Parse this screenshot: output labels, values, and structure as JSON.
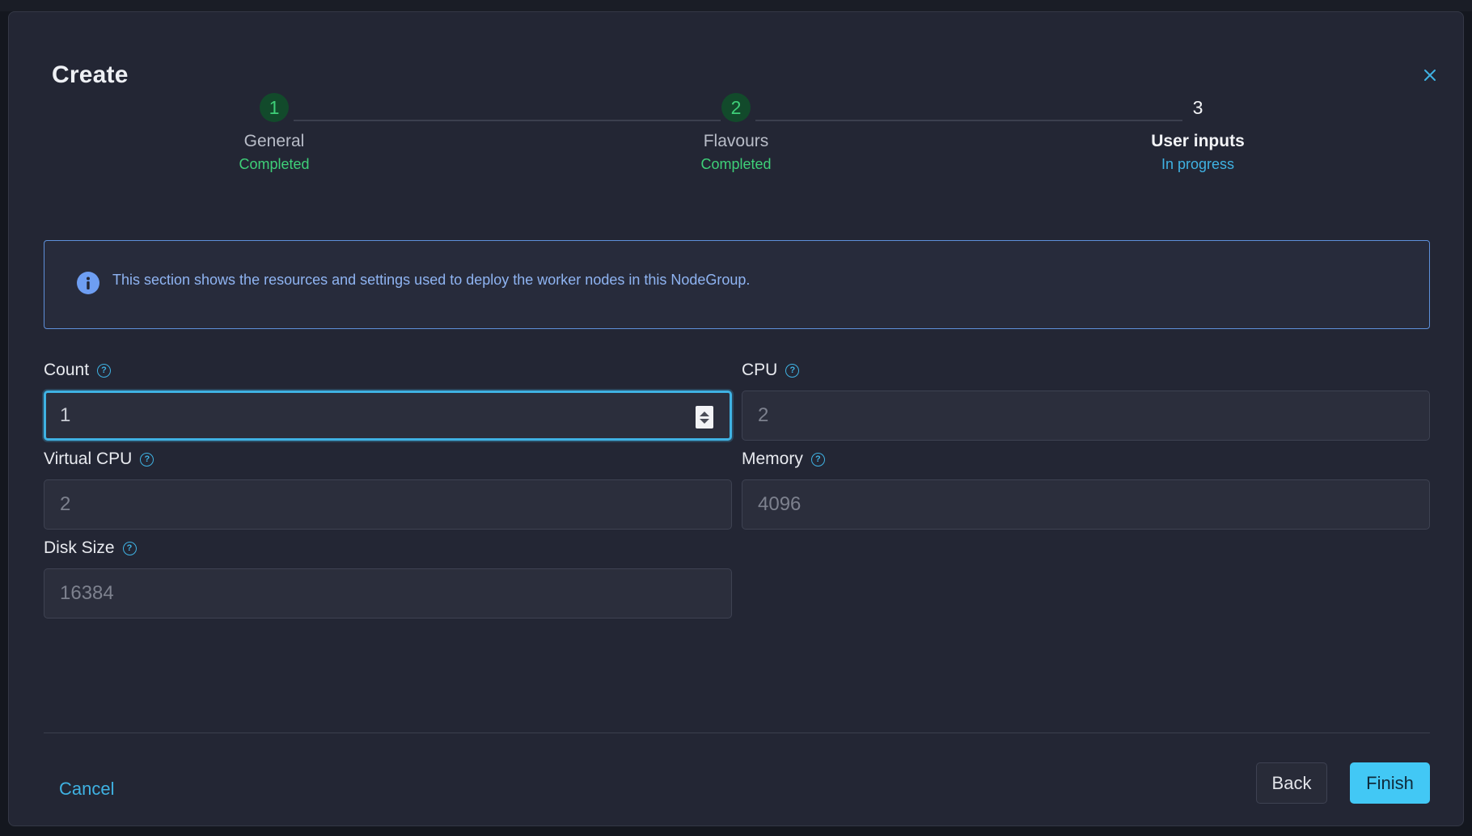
{
  "modal": {
    "title": "Create"
  },
  "stepper": {
    "steps": [
      {
        "number": "1",
        "name": "General",
        "status": "Completed"
      },
      {
        "number": "2",
        "name": "Flavours",
        "status": "Completed"
      },
      {
        "number": "3",
        "name": "User inputs",
        "status": "In progress"
      }
    ]
  },
  "info": {
    "text": "This section shows the resources and settings used to deploy the worker nodes in this NodeGroup."
  },
  "fields": {
    "count": {
      "label": "Count",
      "value": "1"
    },
    "cpu": {
      "label": "CPU",
      "value": "2"
    },
    "virtual_cpu": {
      "label": "Virtual CPU",
      "value": "2"
    },
    "memory": {
      "label": "Memory",
      "value": "4096"
    },
    "disk_size": {
      "label": "Disk Size",
      "value": "16384"
    }
  },
  "footer": {
    "cancel_label": "Cancel",
    "back_label": "Back",
    "finish_label": "Finish"
  },
  "colors": {
    "accent": "#3fb2e3",
    "success": "#3ecf78",
    "info": "#8fb4f2",
    "primary_button": "#42c8f5"
  },
  "icons": {
    "close": "close-icon",
    "info": "info-icon",
    "help": "help-icon"
  }
}
